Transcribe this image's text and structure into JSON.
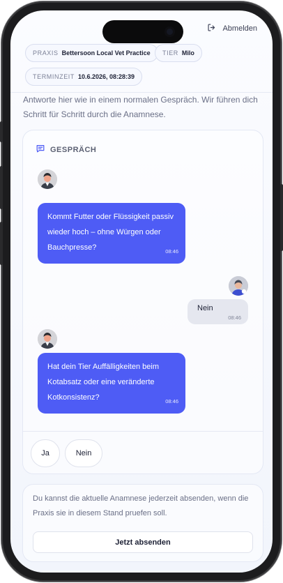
{
  "header": {
    "logout_label": "Abmelden",
    "chips": {
      "praxis_key": "PRAXIS",
      "praxis_value": "Bettersoon Local Vet Practice",
      "tier_key": "TIER",
      "tier_value": "Milo",
      "time_key": "TERMINZEIT",
      "time_value": "10.6.2026, 08:28:39"
    }
  },
  "intro_text": "Antworte hier wie in einem normalen Gespräch. Wir führen dich Schritt für Schritt durch die Anamnese.",
  "conversation": {
    "title": "GESPRÄCH",
    "messages": [
      {
        "role": "assistant",
        "text": "Kommt Futter oder Flüssigkeit passiv wieder hoch – ohne Würgen oder Bauchpresse?",
        "time": "08:46"
      },
      {
        "role": "user",
        "text": "Nein",
        "time": "08:46"
      },
      {
        "role": "assistant",
        "text": "Hat dein Tier Auffälligkeiten beim Kotabsatz oder eine veränderte Kotkonsistenz?",
        "time": "08:46"
      }
    ],
    "answers": [
      "Ja",
      "Nein"
    ]
  },
  "submit": {
    "text": "Du kannst die aktuelle Anamnese jederzeit absenden, wenn die Praxis sie in diesem Stand pruefen soll.",
    "button_label": "Jetzt absenden"
  },
  "colors": {
    "accent": "#4e5cf5",
    "user_bubble": "#e5e7ef",
    "text_primary": "#1d2135",
    "text_muted": "#6a6f86"
  }
}
